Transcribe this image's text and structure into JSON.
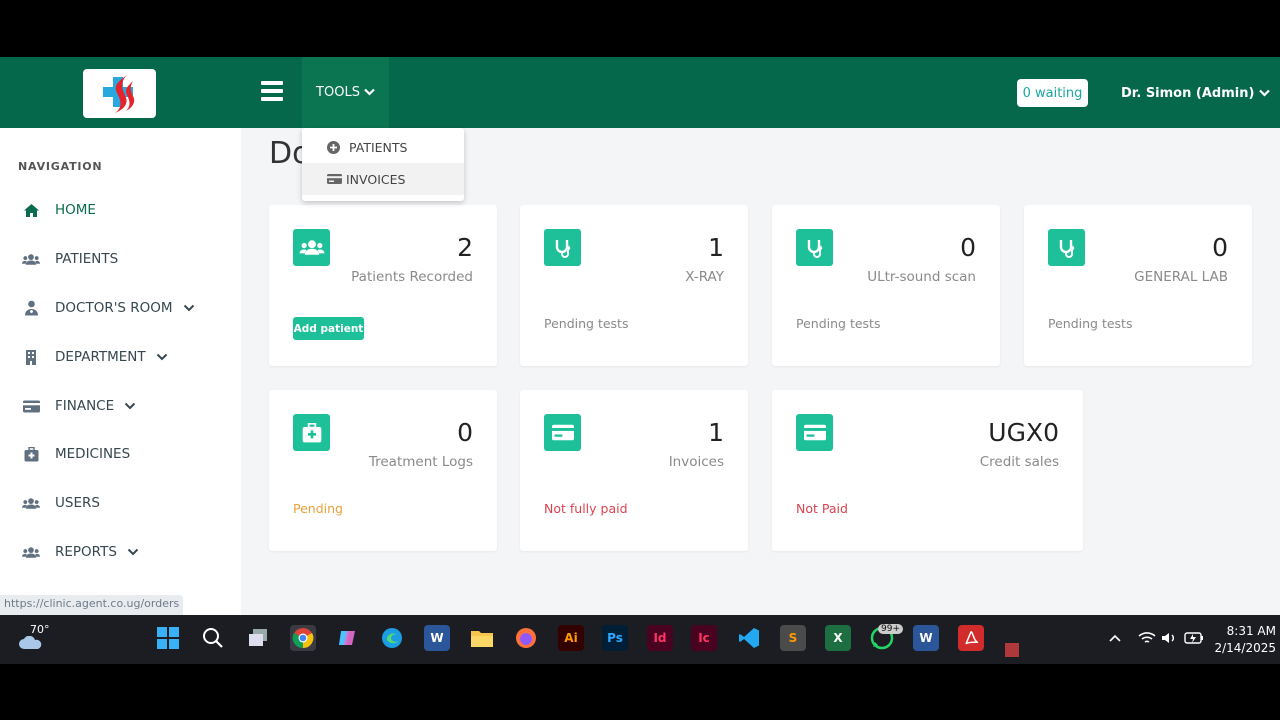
{
  "topbar": {
    "tools_label": "TOOLS",
    "waiting_label": "0 waiting",
    "user_label": "Dr. Simon (Admin)"
  },
  "tools_menu": {
    "items": [
      {
        "label": "PATIENTS",
        "icon": "plus-circle-icon"
      },
      {
        "label": "INVOICES",
        "icon": "credit-card-icon"
      }
    ]
  },
  "sidebar": {
    "title": "NAVIGATION",
    "items": [
      {
        "label": "HOME",
        "icon": "home-icon",
        "active": true
      },
      {
        "label": "PATIENTS",
        "icon": "users-icon"
      },
      {
        "label": "DOCTOR'S ROOM",
        "icon": "doctor-icon",
        "dropdown": true
      },
      {
        "label": "DEPARTMENT",
        "icon": "building-icon",
        "dropdown": true
      },
      {
        "label": "FINANCE",
        "icon": "credit-card-icon",
        "dropdown": true
      },
      {
        "label": "MEDICINES",
        "icon": "medkit-icon"
      },
      {
        "label": "USERS",
        "icon": "users-icon"
      },
      {
        "label": "REPORTS",
        "icon": "users-icon",
        "dropdown": true
      }
    ]
  },
  "main": {
    "page_title": "Do",
    "cards": [
      {
        "value": "2",
        "label": "Patients Recorded",
        "button": "Add patient",
        "icon": "users-icon"
      },
      {
        "value": "1",
        "label": "X-RAY",
        "sub": "Pending tests",
        "icon": "stethoscope-icon"
      },
      {
        "value": "0",
        "label": "ULtr-sound scan",
        "sub": "Pending tests",
        "icon": "stethoscope-icon"
      },
      {
        "value": "0",
        "label": "GENERAL LAB",
        "sub": "Pending tests",
        "icon": "stethoscope-icon"
      },
      {
        "value": "0",
        "label": "Treatment Logs",
        "sub": "Pending",
        "icon": "medkit-icon"
      },
      {
        "value": "1",
        "label": "Invoices",
        "sub": "Not fully paid",
        "icon": "credit-card-icon"
      },
      {
        "value": "UGX0",
        "label": "Credit sales",
        "sub": "Not Paid",
        "icon": "credit-card-icon"
      }
    ]
  },
  "colors": {
    "header": "#06684a",
    "accent": "#1ec09a",
    "pending": "#e9a23b",
    "danger": "#d9434e"
  },
  "status_url": "https://clinic.agent.co.ug/orders",
  "taskbar": {
    "weather": "70°",
    "time": "8:31 AM",
    "date": "2/14/2025",
    "whatsapp_badge": "99+"
  }
}
